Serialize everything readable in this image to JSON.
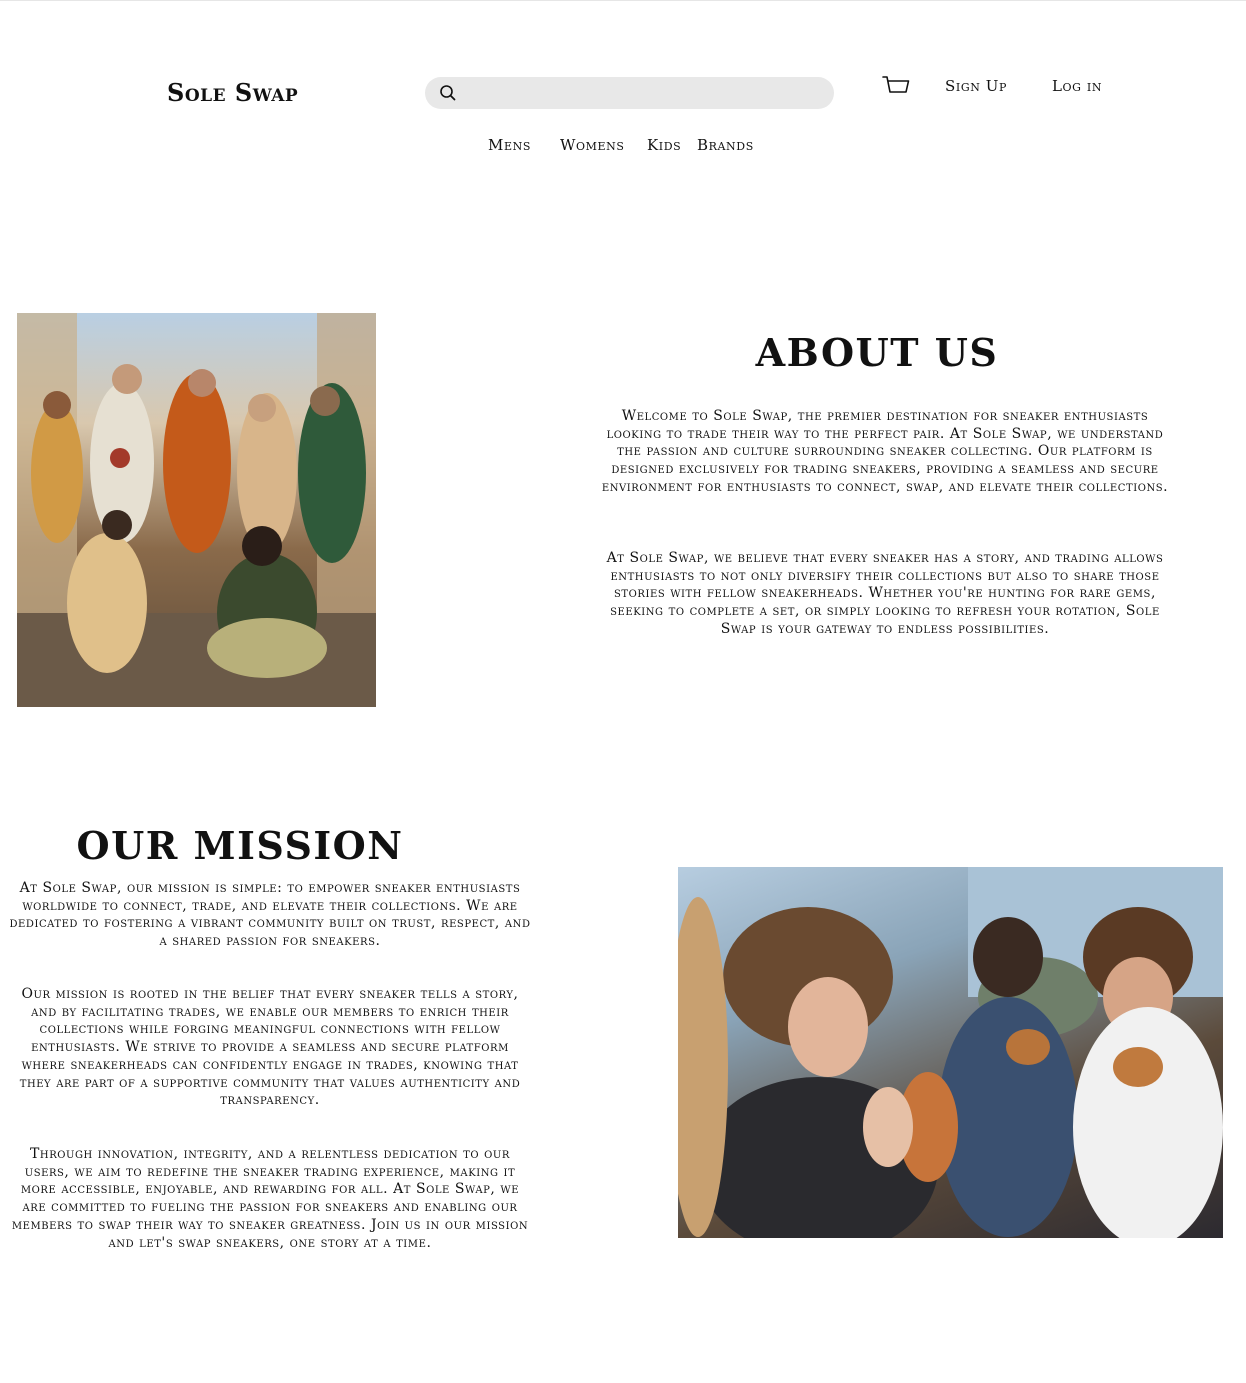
{
  "header": {
    "logo": "Sole Swap",
    "search": {
      "placeholder": "",
      "value": ""
    },
    "signup_label": "Sign Up",
    "login_label": "Log in"
  },
  "nav": {
    "mens": "Mens",
    "womens": "Womens",
    "kids": "Kids",
    "brands": "Brands"
  },
  "about": {
    "title": "ABOUT US",
    "paragraphs": [
      "Welcome to Sole Swap, the premier destination for sneaker enthusiasts looking to trade their way to the perfect pair. At Sole Swap, we understand the passion and culture surrounding sneaker collecting. Our platform is designed exclusively for trading sneakers, providing a seamless and secure environment for enthusiasts to connect, swap, and elevate their collections.",
      "At Sole Swap, we believe that every sneaker has a story, and trading allows enthusiasts to not only diversify their collections but also to share those stories with fellow sneakerheads. Whether you're hunting for rare gems, seeking to complete a set, or simply looking to refresh your rotation, Sole Swap is your gateway to endless possibilities."
    ]
  },
  "mission": {
    "title": "OUR MISSION",
    "paragraphs": [
      "At Sole Swap, our mission is simple: to empower sneaker enthusiasts worldwide to connect, trade, and elevate their collections. We are dedicated to fostering a vibrant community built on trust, respect, and a shared passion for sneakers.",
      "Our mission is rooted in the belief that every sneaker tells a story, and by facilitating trades, we enable our members to enrich their collections while forging meaningful connections with fellow enthusiasts. We strive to provide a seamless and secure platform where sneakerheads can confidently engage in trades, knowing that they are part of a supportive community that values authenticity and transparency.",
      "Through innovation, integrity, and a relentless dedication to our users, we aim to redefine the sneaker trading experience, making it more accessible, enjoyable, and rewarding for all. At Sole Swap, we are committed to fueling the passion for sneakers and enabling our members to swap their way to sneaker greatness. Join us in our mission and let's swap sneakers, one story at a time."
    ]
  },
  "icons": {
    "search": "search-icon",
    "cart": "shopping-basket-icon"
  }
}
